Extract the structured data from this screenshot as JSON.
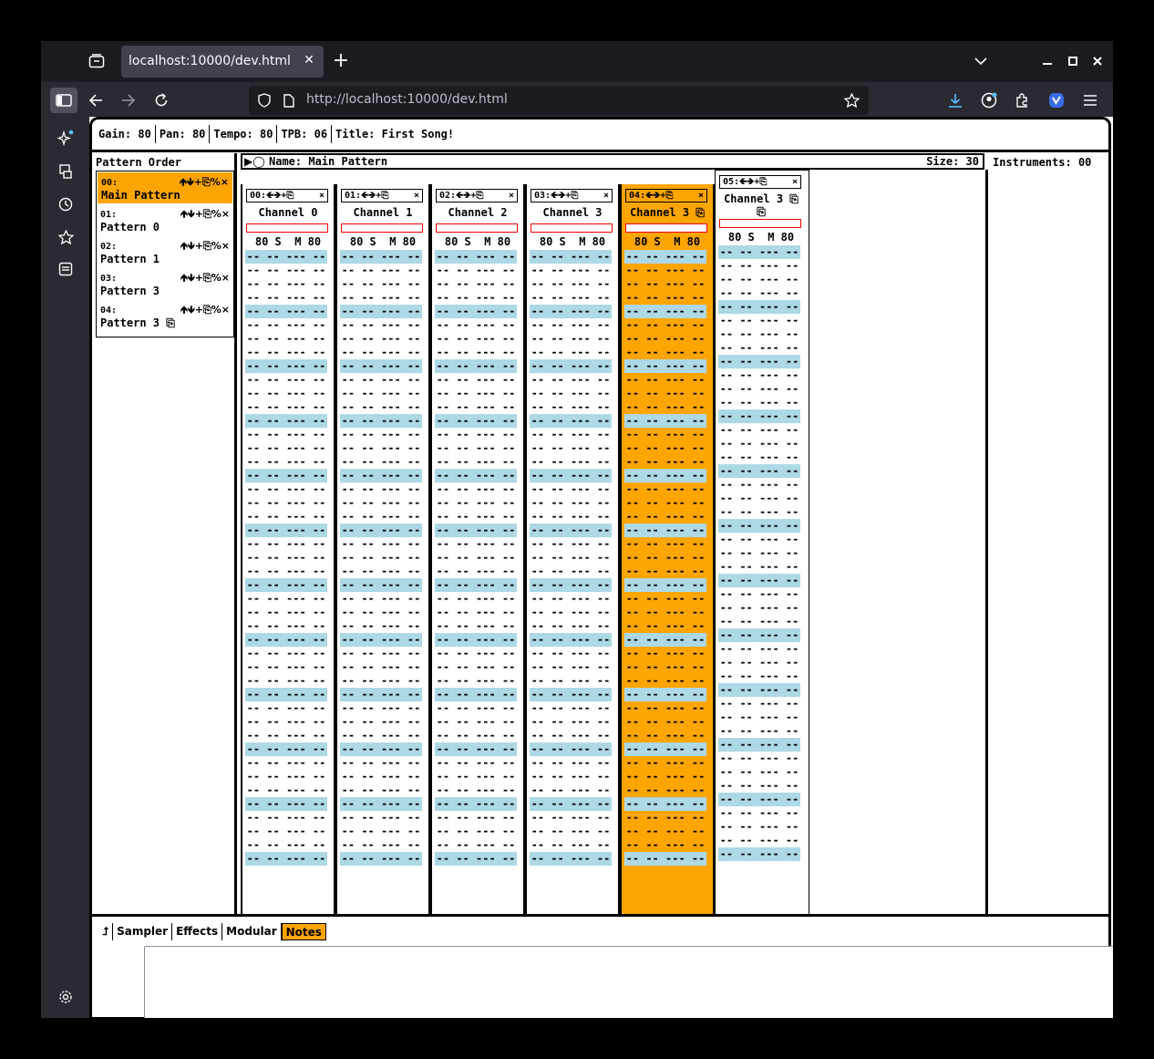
{
  "browser": {
    "tab_title": "localhost:10000/dev.html",
    "url": "http://localhost:10000/dev.html",
    "icons": [
      "tab-overview-icon",
      "new-tab-icon",
      "list-tabs-icon",
      "minimize-icon",
      "maximize-icon",
      "close-window-icon",
      "sidebar-toggle-icon",
      "back-icon",
      "forward-icon",
      "reload-icon",
      "shield-icon",
      "page-icon",
      "bookmark-star-icon",
      "downloads-icon",
      "account-icon",
      "extensions-icon",
      "vpn-icon",
      "menu-icon",
      "ai-chat-icon",
      "synced-tabs-icon",
      "history-icon",
      "bookmarks-icon",
      "reader-icon",
      "settings-icon"
    ]
  },
  "song": {
    "gain_label": "Gain:",
    "gain": "80",
    "pan_label": "Pan:",
    "pan": "80",
    "tempo_label": "Tempo:",
    "tempo": "80",
    "tpb_label": "TPB:",
    "tpb": "06",
    "title_label": "Title:",
    "title": "First Song!"
  },
  "pattern_order": {
    "heading": "Pattern Order",
    "controls": "🡹🡻+⎘%×",
    "items": [
      {
        "num": "00:",
        "name": "Main Pattern",
        "selected": true
      },
      {
        "num": "01:",
        "name": "Pattern 0"
      },
      {
        "num": "02:",
        "name": "Pattern 1"
      },
      {
        "num": "03:",
        "name": "Pattern 3"
      },
      {
        "num": "04:",
        "name": "Pattern 3 ⎘"
      }
    ]
  },
  "pattern": {
    "play_controls": "▶◯",
    "name_label": "Name:",
    "name": "Main Pattern",
    "size_label": "Size:",
    "size": "30",
    "row_text": "-- -- --- --",
    "channels": [
      {
        "ctrl": "00:🡸🡺+⎘",
        "close": "×",
        "name": "Channel 0",
        "mix": "80 S  M 80"
      },
      {
        "ctrl": "01:🡸🡺+⎘",
        "close": "×",
        "name": "Channel 1",
        "mix": "80 S  M 80"
      },
      {
        "ctrl": "02:🡸🡺+⎘",
        "close": "×",
        "name": "Channel 2",
        "mix": "80 S  M 80"
      },
      {
        "ctrl": "03:🡸🡺+⎘",
        "close": "×",
        "name": "Channel 3",
        "mix": "80 S  M 80"
      },
      {
        "ctrl": "04:🡸🡺+⎘",
        "close": "×",
        "name": "Channel 3 ⎘",
        "mix": "80 S  M 80",
        "selected": true
      },
      {
        "ctrl": "05:🡸🡺+⎘",
        "close": "×",
        "name": "Channel 3 ⎘",
        "name2": "⎘",
        "mix": "80 S  M 80"
      }
    ]
  },
  "instruments": {
    "label": "Instruments:",
    "count": "00"
  },
  "bottom_tabs": {
    "items": [
      "⮥",
      "Sampler",
      "Effects",
      "Modular",
      "Notes"
    ],
    "active": "Notes"
  },
  "colors": {
    "selected": "#ffa500",
    "beat_row": "#add8e6",
    "level_bar": "#e00000"
  }
}
